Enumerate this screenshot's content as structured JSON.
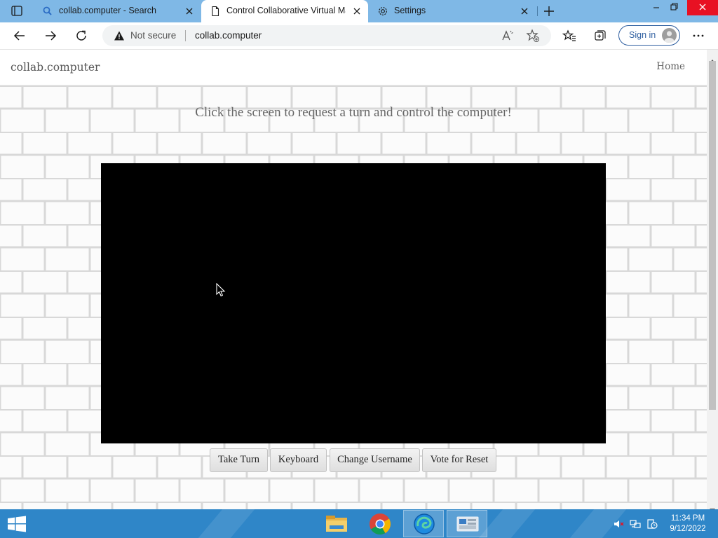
{
  "browser": {
    "tabs": [
      {
        "label": "collab.computer - Search",
        "icon": "search-icon",
        "active": false
      },
      {
        "label": "Control Collaborative Virtual Ma",
        "icon": "page-icon",
        "active": true
      },
      {
        "label": "Settings",
        "icon": "gear-icon",
        "active": false
      }
    ],
    "address": {
      "security_label": "Not secure",
      "url": "collab.computer"
    },
    "signin_label": "Sign in",
    "colors": {
      "tabstrip": "#7fb8e6",
      "close_button": "#e81123"
    }
  },
  "page": {
    "brand": "collab.computer",
    "nav_home": "Home",
    "headline": "Click the screen to request a turn and control the computer!",
    "buttons": [
      "Take Turn",
      "Keyboard",
      "Change Username",
      "Vote for Reset"
    ]
  },
  "taskbar": {
    "apps": [
      "file-explorer-icon",
      "chrome-icon",
      "edge-icon",
      "server-manager-icon"
    ],
    "active_app": "edge-icon",
    "clock_time": "11:34 PM",
    "clock_date": "9/12/2022",
    "color": "#2f86c8"
  }
}
